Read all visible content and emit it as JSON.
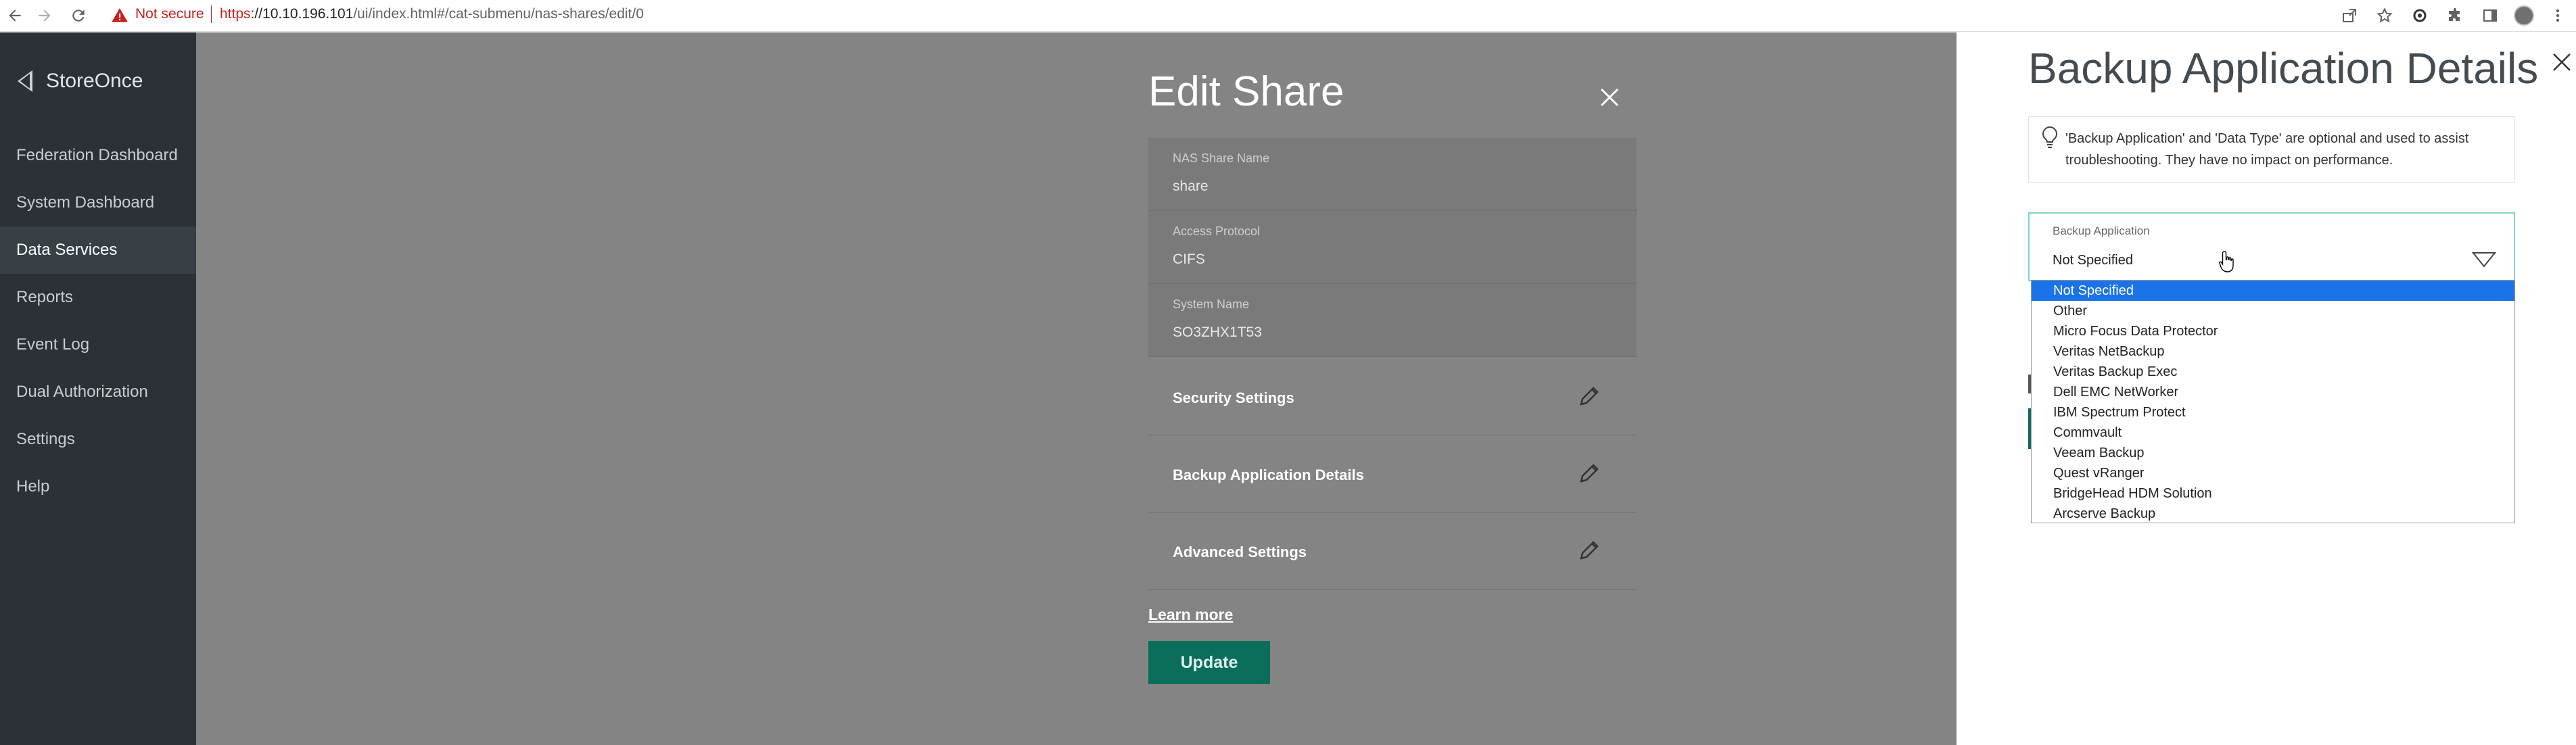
{
  "browser": {
    "security_label": "Not secure",
    "url_scheme": "https",
    "url_host": "://10.10.196.101",
    "url_path": "/ui/index.html#/cat-submenu/nas-shares/edit/0"
  },
  "sidebar": {
    "brand": "StoreOnce",
    "items": [
      {
        "label": "Federation Dashboard"
      },
      {
        "label": "System Dashboard"
      },
      {
        "label": "Data Services",
        "active": true
      },
      {
        "label": "Reports"
      },
      {
        "label": "Event Log"
      },
      {
        "label": "Dual Authorization"
      },
      {
        "label": "Settings"
      },
      {
        "label": "Help"
      }
    ]
  },
  "edit_share": {
    "title": "Edit Share",
    "fields": [
      {
        "label": "NAS Share Name",
        "value": "share"
      },
      {
        "label": "Access Protocol",
        "value": "CIFS"
      },
      {
        "label": "System Name",
        "value": "SO3ZHX1T53"
      }
    ],
    "sections": [
      {
        "label": "Security Settings"
      },
      {
        "label": "Backup Application Details"
      },
      {
        "label": "Advanced Settings"
      }
    ],
    "learn_more": "Learn more",
    "update_label": "Update"
  },
  "panel": {
    "title": "Backup Application Details",
    "info_text": "'Backup Application' and 'Data Type' are optional and used to assist troubleshooting. They have no impact on performance.",
    "select_label": "Backup Application",
    "select_value": "Not Specified",
    "options": [
      "Not Specified",
      "Other",
      "Micro Focus Data Protector",
      "Veritas NetBackup",
      "Veritas Backup Exec",
      "Dell EMC NetWorker",
      "IBM Spectrum Protect",
      "Commvault",
      "Veeam Backup",
      "Quest vRanger",
      "BridgeHead HDM Solution",
      "Arcserve Backup"
    ],
    "selected_index": 0
  },
  "colors": {
    "sidebar_bg": "#2b3136",
    "accent_green": "#0a6e5a",
    "select_border": "#7fd3c8",
    "option_highlight": "#1a73e8"
  }
}
